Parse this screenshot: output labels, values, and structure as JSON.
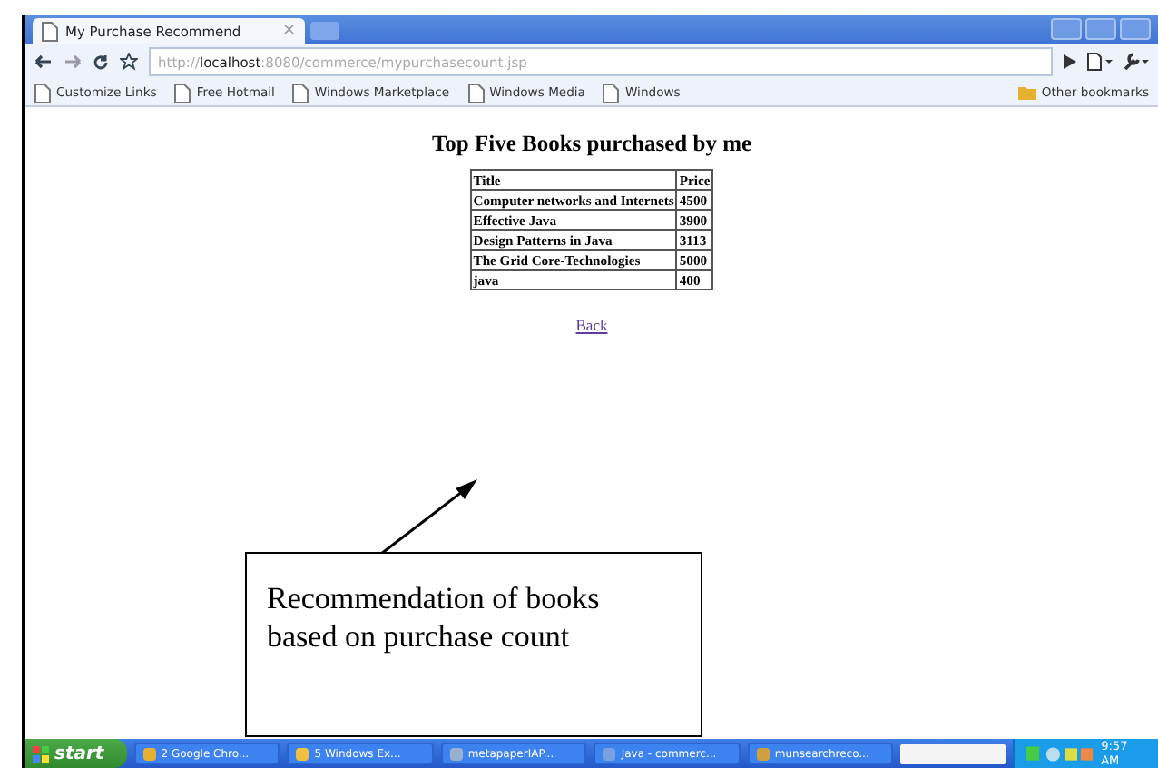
{
  "browser": {
    "tab": {
      "title": "My Purchase Recommend",
      "close": "×"
    },
    "address": {
      "scheme": "http://",
      "host": "localhost",
      "rest": ":8080/commerce/mypurchasecount.jsp"
    },
    "bookmarks": [
      "Customize Links",
      "Free Hotmail",
      "Windows Marketplace",
      "Windows Media",
      "Windows"
    ],
    "other_bookmarks": "Other bookmarks"
  },
  "page": {
    "heading": "Top Five Books purchased by me",
    "table": {
      "columns": [
        "Title",
        "Price"
      ],
      "rows": [
        [
          "Computer networks and Internets",
          "4500"
        ],
        [
          "Effective Java",
          "3900"
        ],
        [
          "Design Patterns in Java",
          "3113"
        ],
        [
          "The Grid Core-Technologies",
          "5000"
        ],
        [
          "java",
          "400"
        ]
      ]
    },
    "link": "Back"
  },
  "annotation": "Recommendation of books based on purchase count",
  "taskbar": {
    "start": "start",
    "tasks": [
      "2 Google Chro...",
      "5 Windows Ex...",
      "metapaperIAP...",
      "Java - commerc...",
      "munsearchreco..."
    ],
    "clock": "9:57 AM"
  }
}
